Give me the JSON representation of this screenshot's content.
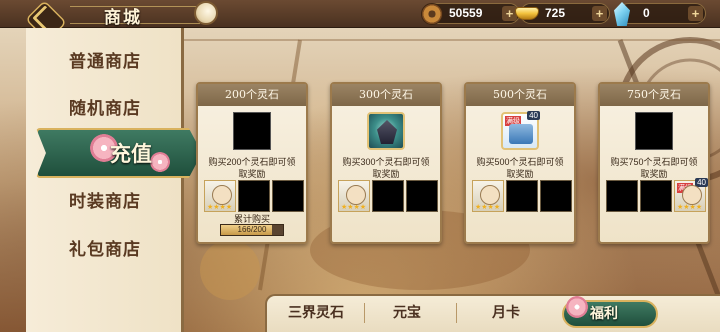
{
  "header": {
    "title": "商城",
    "back_icon": "back-arrow-icon"
  },
  "resources": [
    {
      "name": "coin",
      "icon": "coin-icon",
      "value": "50559"
    },
    {
      "name": "ingot",
      "icon": "gold-ingot-icon",
      "value": "725"
    },
    {
      "name": "crystal",
      "icon": "blue-crystal-icon",
      "value": "0"
    }
  ],
  "sidebar": {
    "items": [
      {
        "label": "普通商店"
      },
      {
        "label": "随机商店"
      },
      {
        "label": "充值"
      },
      {
        "label": "时装商店"
      },
      {
        "label": "礼包商店"
      }
    ],
    "active_index": 2
  },
  "cards": [
    {
      "title": "200个灵石",
      "desc": "购买200个灵石即可领取奖励",
      "progress_label": "累计购买",
      "progress_text": "166/200",
      "progress_fraction": 0.83
    },
    {
      "title": "300个灵石",
      "desc": "购买300个灵石即可领取奖励"
    },
    {
      "title": "500个灵石",
      "desc": "购买500个灵石即可领取奖励",
      "badge_full": "满级",
      "badge_level": "40"
    },
    {
      "title": "750个灵石",
      "desc": "购买750个灵石即可领取奖励",
      "badge_full": "满级",
      "badge_level": "40"
    }
  ],
  "bottom_tabs": {
    "items": [
      {
        "label": "三界灵石"
      },
      {
        "label": "元宝"
      },
      {
        "label": "月卡"
      },
      {
        "label": "福利"
      }
    ],
    "active_index": 3
  },
  "plus_symbol": "+",
  "stars_symbol": "★★★★"
}
